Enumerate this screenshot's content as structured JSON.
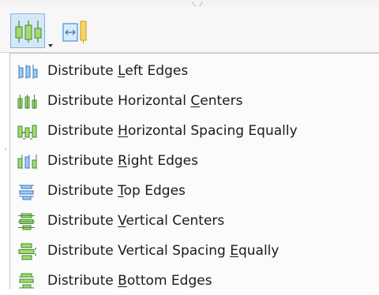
{
  "menu": {
    "items": [
      {
        "pre": "Distribute ",
        "key": "L",
        "post": "eft Edges",
        "icon": "distribute-left-edges-icon"
      },
      {
        "pre": "Distribute Horizontal ",
        "key": "C",
        "post": "enters",
        "icon": "distribute-horizontal-centers-icon"
      },
      {
        "pre": "Distribute ",
        "key": "H",
        "post": "orizontal Spacing Equally",
        "icon": "distribute-horizontal-spacing-icon"
      },
      {
        "pre": "Distribute ",
        "key": "R",
        "post": "ight Edges",
        "icon": "distribute-right-edges-icon"
      },
      {
        "pre": "Distribute ",
        "key": "T",
        "post": "op Edges",
        "icon": "distribute-top-edges-icon"
      },
      {
        "pre": "Distribute ",
        "key": "V",
        "post": "ertical Centers",
        "icon": "distribute-vertical-centers-icon"
      },
      {
        "pre": "Distribute Vertical Spacing ",
        "key": "E",
        "post": "qually",
        "icon": "distribute-vertical-spacing-icon"
      },
      {
        "pre": "Distribute ",
        "key": "B",
        "post": "ottom Edges",
        "icon": "distribute-bottom-edges-icon"
      }
    ]
  },
  "toolbar": {
    "buttons": [
      {
        "icon": "distribute-horizontal-icon",
        "has_dropdown": true,
        "active": true
      },
      {
        "icon": "fit-width-icon",
        "has_dropdown": false,
        "active": false
      }
    ]
  },
  "colors": {
    "icon_green": "#8dc63f",
    "icon_blue": "#4a90d9",
    "icon_yellow": "#f2c744",
    "active_button_bg": "#d6e8f7"
  }
}
